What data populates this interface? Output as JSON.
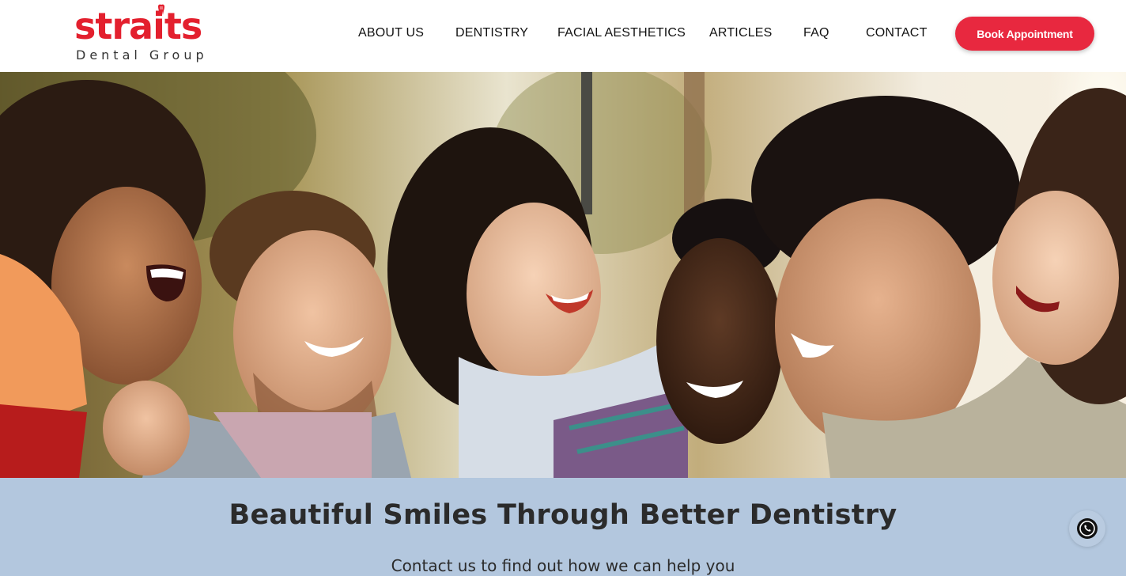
{
  "brand": {
    "name": "straits",
    "subtitle": "Dental Group",
    "accent_color": "#e3202e"
  },
  "nav": {
    "items": [
      {
        "label": "ABOUT US"
      },
      {
        "label": "DENTISTRY"
      },
      {
        "label": "FACIAL AESTHETICS"
      },
      {
        "label": "ARTICLES"
      },
      {
        "label": "FAQ"
      },
      {
        "label": "CONTACT"
      }
    ],
    "cta_label": "Book Appointment",
    "cta_color": "#e8283f"
  },
  "hero": {
    "image_icon": "group-of-smiling-friends-photo"
  },
  "banner": {
    "title": "Beautiful Smiles Through Better Dentistry",
    "subtitle": "Contact us to find out how we can help you",
    "background": "#b3c7de"
  },
  "floating": {
    "icon": "whatsapp-icon"
  }
}
